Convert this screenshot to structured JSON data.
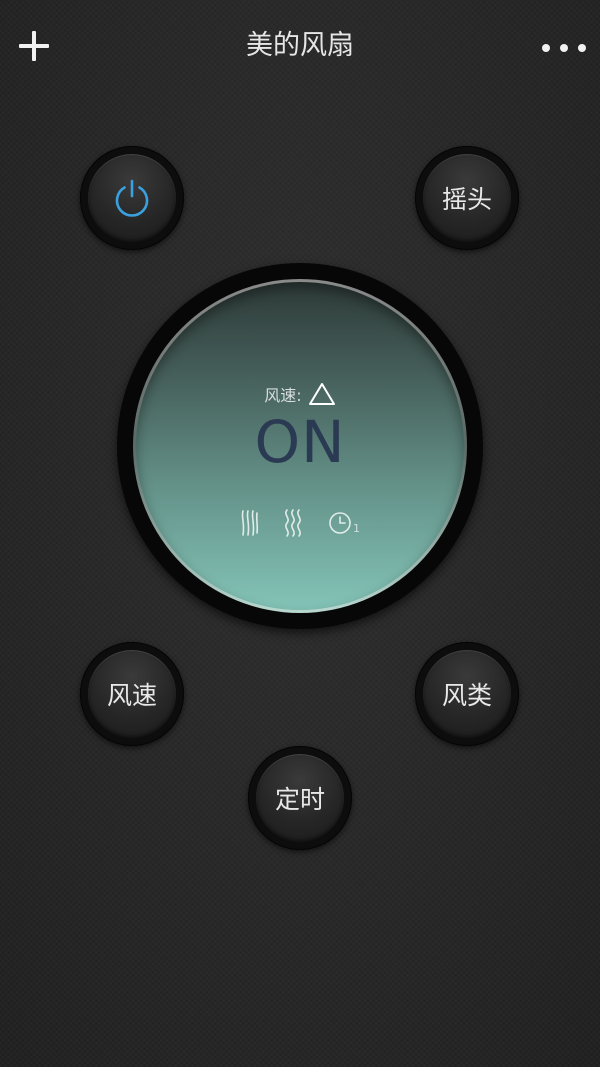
{
  "header": {
    "title": "美的风扇"
  },
  "buttons": {
    "swing_label": "摇头",
    "speed_label": "风速",
    "type_label": "风类",
    "timer_label": "定时"
  },
  "display": {
    "speed_label": "风速:",
    "status": "ON",
    "timer_count": "1"
  },
  "icons": {
    "add": "plus-icon",
    "more": "more-dots-icon",
    "power": "power-icon",
    "speed_level": "triangle-icon",
    "mode_normal": "wind-lines-icon",
    "mode_natural": "wind-waves-icon",
    "timer": "clock-icon"
  },
  "colors": {
    "power_accent": "#3aa0e0",
    "status_text": "#2a3a52",
    "dial_bottom": "#84c4b8"
  }
}
